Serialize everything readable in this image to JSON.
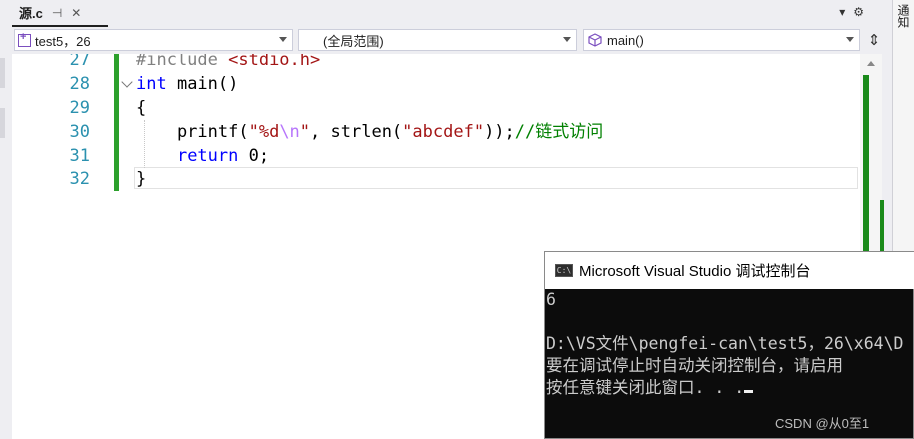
{
  "tab": {
    "title": "源.c",
    "pin_icon": "pin-icon",
    "close_icon": "close-icon"
  },
  "tab_actions": {
    "dropdown_icon": "chevron-down-icon",
    "settings_icon": "gear-icon"
  },
  "side_panel": {
    "label": "通知"
  },
  "navbar": {
    "project": "test5，26",
    "scope": "(全局范围)",
    "member": "main()"
  },
  "editor": {
    "lines": [
      {
        "number": "27",
        "tokens": [
          {
            "t": "#include ",
            "c": "pp"
          },
          {
            "t": "<stdio.h>",
            "c": "str"
          }
        ]
      },
      {
        "number": "28",
        "tokens": [
          {
            "t": "int",
            "c": "kw"
          },
          {
            "t": " main()",
            "c": "fn"
          }
        ]
      },
      {
        "number": "29",
        "tokens": [
          {
            "t": "{",
            "c": "fn"
          }
        ]
      },
      {
        "number": "30",
        "tokens": [
          {
            "t": "    printf(",
            "c": "fn"
          },
          {
            "t": "\"%d",
            "c": "str"
          },
          {
            "t": "\\n",
            "c": "esc"
          },
          {
            "t": "\"",
            "c": "str"
          },
          {
            "t": ", strlen(",
            "c": "fn"
          },
          {
            "t": "\"abcdef\"",
            "c": "str"
          },
          {
            "t": "));",
            "c": "fn"
          },
          {
            "t": "//链式访问",
            "c": "cmt"
          }
        ]
      },
      {
        "number": "31",
        "tokens": [
          {
            "t": "    ",
            "c": "fn"
          },
          {
            "t": "return",
            "c": "kw"
          },
          {
            "t": " 0;",
            "c": "fn"
          }
        ]
      },
      {
        "number": "32",
        "tokens": [
          {
            "t": "}",
            "c": "fn"
          }
        ]
      }
    ]
  },
  "console": {
    "title": "Microsoft Visual Studio 调试控制台",
    "lines": [
      "6",
      "",
      "D:\\VS文件\\pengfei-can\\test5，26\\x64\\D",
      "要在调试停止时自动关闭控制台，请启用",
      "按任意键关闭此窗口. . ."
    ]
  },
  "watermark": "CSDN @从0至1"
}
